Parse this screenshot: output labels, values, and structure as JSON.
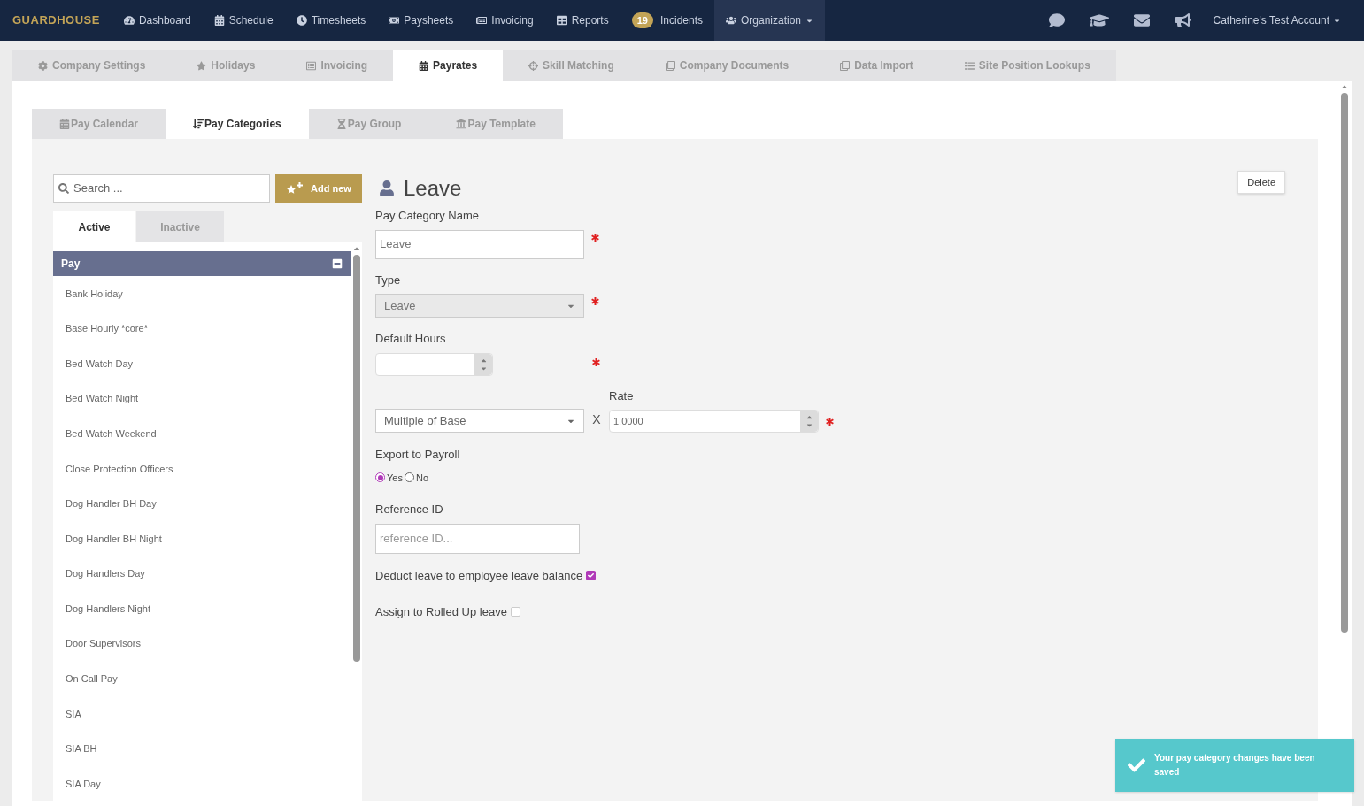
{
  "navbar": {
    "brand": "GUARDHOUSE",
    "items": [
      {
        "label": "Dashboard",
        "selected": false
      },
      {
        "label": "Schedule",
        "selected": false
      },
      {
        "label": "Timesheets",
        "selected": false
      },
      {
        "label": "Paysheets",
        "selected": false
      },
      {
        "label": "Invoicing",
        "selected": false
      },
      {
        "label": "Reports",
        "selected": false
      },
      {
        "label": "Incidents",
        "badge": "19",
        "selected": false
      },
      {
        "label": "Organization",
        "selected": true,
        "menu": true
      }
    ],
    "account": "Catherine's Test Account"
  },
  "top_tabs": [
    {
      "label": "Company Settings",
      "selected": false
    },
    {
      "label": "Holidays",
      "selected": false
    },
    {
      "label": "Invoicing",
      "selected": false
    },
    {
      "label": "Payrates",
      "selected": true
    },
    {
      "label": "Skill Matching",
      "selected": false
    },
    {
      "label": "Company Documents",
      "selected": false
    },
    {
      "label": "Data Import",
      "selected": false
    },
    {
      "label": "Site Position Lookups",
      "selected": false
    }
  ],
  "sub_tabs": [
    {
      "label": "Pay Calendar",
      "selected": false
    },
    {
      "label": "Pay Categories",
      "selected": true
    },
    {
      "label": "Pay Group",
      "selected": false
    },
    {
      "label": "Pay Template",
      "selected": false
    }
  ],
  "sidebar": {
    "search_placeholder": "Search ...",
    "add_button": "Add new",
    "tabs": [
      {
        "label": "Active",
        "selected": true
      },
      {
        "label": "Inactive",
        "selected": false
      }
    ],
    "group": {
      "title": "Pay",
      "expanded": true,
      "items": [
        "Bank Holiday",
        "Base Hourly *core*",
        "Bed Watch Day",
        "Bed Watch Night",
        "Bed Watch Weekend",
        "Close Protection Officers",
        "Dog Handler BH Day",
        "Dog Handler BH Night",
        "Dog Handlers Day",
        "Dog Handlers Night",
        "Door Supervisors",
        "On Call Pay",
        "SIA",
        "SIA BH",
        "SIA Day"
      ]
    }
  },
  "form": {
    "title": "Leave",
    "delete_button": "Delete",
    "name_label": "Pay Category Name",
    "name_value": "Leave",
    "type_label": "Type",
    "type_value": "Leave",
    "type_disabled": true,
    "hours_label": "Default Hours",
    "rate_basis": "Multiple of Base",
    "times": "X",
    "rate_label": "Rate",
    "rate_value": "1.0000",
    "export_label": "Export to Payroll",
    "export_options": [
      {
        "label": "Yes",
        "selected": true
      },
      {
        "label": "No",
        "selected": false
      }
    ],
    "reference_label": "Reference ID",
    "reference_placeholder": "reference ID...",
    "deduct_label": "Deduct leave to employee leave balance",
    "deduct_checked": true,
    "rolled_label": "Assign to Rolled Up leave",
    "rolled_checked": false
  },
  "toast": "Your pay category changes have been saved"
}
